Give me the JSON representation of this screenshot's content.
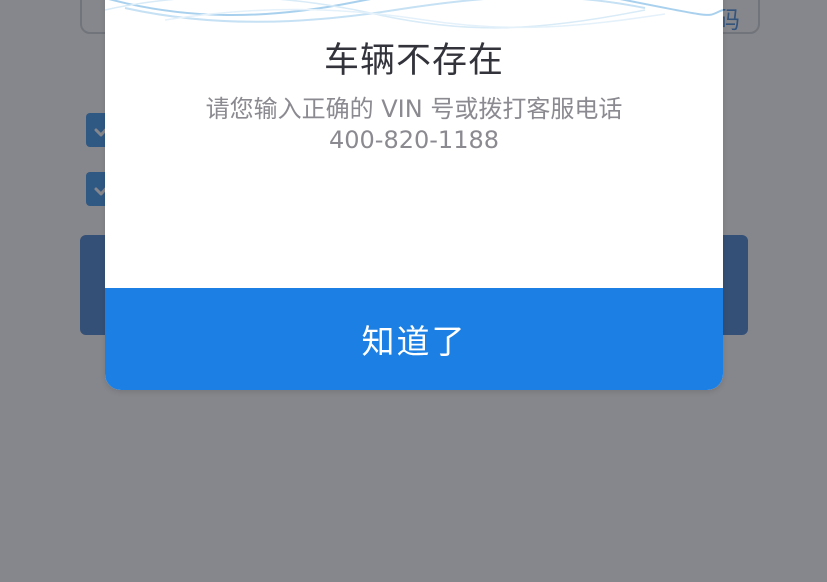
{
  "background": {
    "link_text": "码"
  },
  "dialog": {
    "title": "车辆不存在",
    "message_line1": "请您输入正确的 VIN 号或拨打客服电话",
    "message_line2": "400-820-1188",
    "confirm_label": "知道了"
  },
  "colors": {
    "overlay": "#3c3e46",
    "primary_button": "#1b7fe3",
    "background_button": "#2a6fc9",
    "checkbox": "#1b83e6",
    "title_text": "#33333c",
    "message_text": "#8a8a90"
  }
}
